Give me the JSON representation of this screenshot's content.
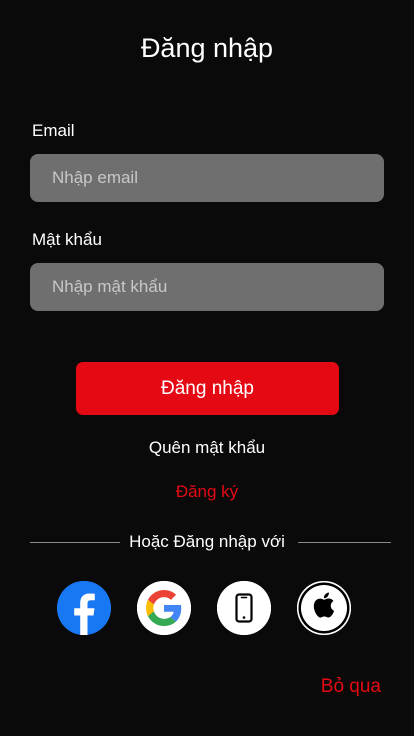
{
  "screen": {
    "title": "Đăng nhập"
  },
  "form": {
    "email_label": "Email",
    "email_placeholder": "Nhập email",
    "email_value": "",
    "password_label": "Mật khẩu",
    "password_placeholder": "Nhập mật khẩu",
    "password_value": "",
    "submit_label": "Đăng nhập"
  },
  "links": {
    "forgot_password": "Quên mật khẩu",
    "register": "Đăng ký"
  },
  "social": {
    "divider_text": "Hoặc Đăng nhập với",
    "providers": [
      {
        "name": "facebook",
        "icon": "facebook-icon"
      },
      {
        "name": "google",
        "icon": "google-icon"
      },
      {
        "name": "phone",
        "icon": "phone-icon"
      },
      {
        "name": "apple",
        "icon": "apple-icon"
      }
    ]
  },
  "skip_label": "Bỏ qua",
  "colors": {
    "background": "#0a0a0a",
    "accent": "#e50914",
    "input_background": "#6f6f6f",
    "facebook_blue": "#1877f2"
  }
}
